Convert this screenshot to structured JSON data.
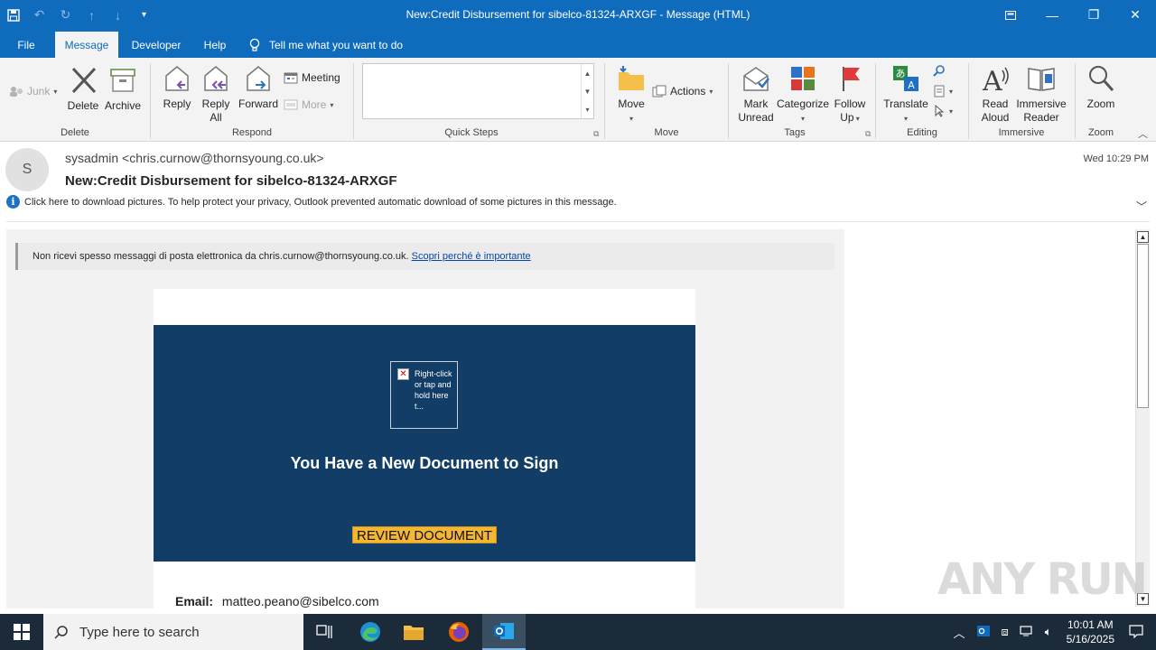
{
  "window": {
    "title": "New:Credit Disbursement for sibelco-81324-ARXGF  -  Message (HTML)"
  },
  "menu": {
    "tabs": [
      "File",
      "Message",
      "Developer",
      "Help"
    ],
    "tell_me": "Tell me what you want to do"
  },
  "ribbon": {
    "junk": "Junk",
    "delete": "Delete",
    "archive": "Archive",
    "group_delete": "Delete",
    "reply": "Reply",
    "reply_all_1": "Reply",
    "reply_all_2": "All",
    "forward": "Forward",
    "meeting": "Meeting",
    "more": "More",
    "group_respond": "Respond",
    "group_quick_steps": "Quick Steps",
    "move": "Move",
    "actions": "Actions",
    "group_move": "Move",
    "mark_unread_1": "Mark",
    "mark_unread_2": "Unread",
    "categorize": "Categorize",
    "follow_up_1": "Follow",
    "follow_up_2": "Up",
    "group_tags": "Tags",
    "translate": "Translate",
    "group_editing": "Editing",
    "read_aloud_1": "Read",
    "read_aloud_2": "Aloud",
    "immersive_reader_1": "Immersive",
    "immersive_reader_2": "Reader",
    "group_immersive": "Immersive",
    "zoom": "Zoom",
    "group_zoom": "Zoom"
  },
  "message": {
    "avatar_initial": "S",
    "sender": "sysadmin <chris.curnow@thornsyoung.co.uk>",
    "subject": "New:Credit Disbursement for sibelco-81324-ARXGF",
    "date": "Wed 10:29 PM",
    "info_bar": "Click here to download pictures. To help protect your privacy, Outlook prevented automatic download of some pictures in this message."
  },
  "body": {
    "banner_text": "Non ricevi spesso messaggi di posta elettronica da chris.curnow@thornsyoung.co.uk.",
    "banner_link": "Scopri perché è importante",
    "image_alt": "Right-click or tap and hold here t...",
    "headline": "You Have a New Document to Sign",
    "button": "REVIEW DOCUMENT",
    "email_label": "Email:",
    "email_value": "matteo.peano@sibelco.com"
  },
  "watermark": "ANY RUN",
  "taskbar": {
    "search_placeholder": "Type here to search",
    "time": "10:01 AM",
    "date": "5/16/2025"
  },
  "colors": {
    "accent": "#0f6cbd",
    "hero": "#123d66",
    "button": "#f5b731"
  }
}
